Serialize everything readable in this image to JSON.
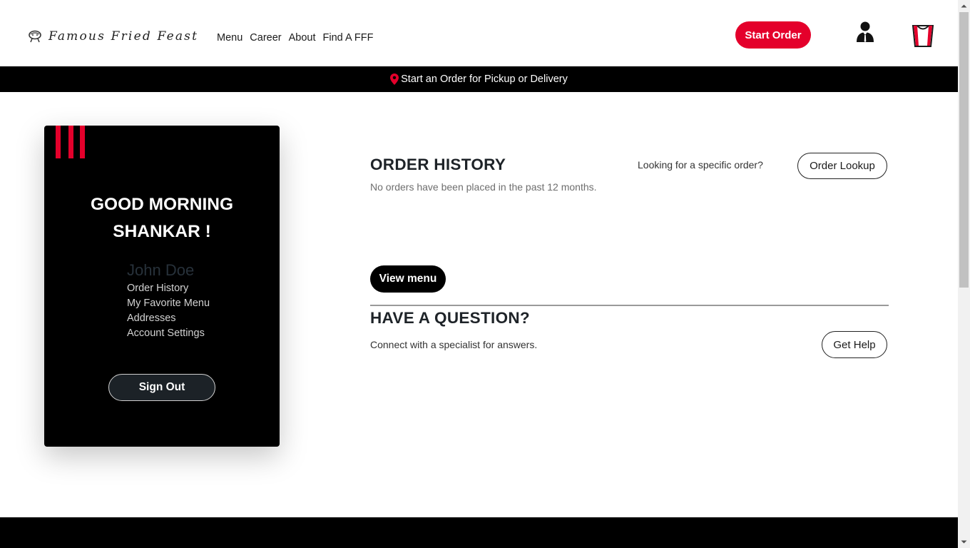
{
  "header": {
    "brand": "Famous Fried Feast",
    "nav": [
      "Menu",
      "Career",
      "About",
      "Find A FFF"
    ],
    "start_order": "Start Order"
  },
  "banner": {
    "text": "Start an Order for Pickup or Delivery"
  },
  "profile": {
    "greeting_line1": "GOOD MORNING",
    "greeting_line2": "SHANKAR !",
    "name": "John Doe",
    "links": [
      "Order History",
      "My Favorite Menu",
      "Addresses",
      "Account Settings"
    ],
    "sign_out": "Sign Out"
  },
  "order_history": {
    "title": "ORDER HISTORY",
    "subtitle": "No orders have been placed in the past 12 months.",
    "lookup_question": "Looking for a specific order?",
    "lookup_button": "Order Lookup",
    "view_menu": "View menu"
  },
  "question": {
    "title": "HAVE A QUESTION?",
    "subtitle": "Connect with a specialist for answers.",
    "help_button": "Get Help"
  },
  "colors": {
    "accent": "#e4002b",
    "band": "#000000",
    "card": "#000000"
  },
  "icons": [
    "fried-chicken-logo-icon",
    "location-pin-icon",
    "user-account-icon",
    "bucket-cart-icon"
  ]
}
